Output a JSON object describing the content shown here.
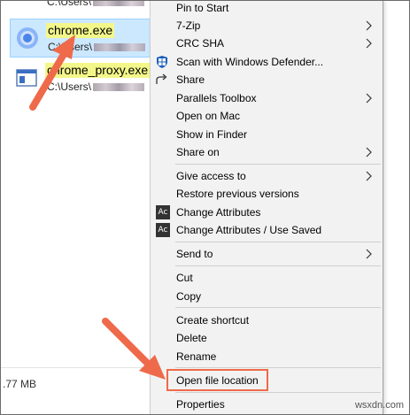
{
  "results": {
    "partial_path_top": "C:\\Users\\",
    "items": [
      {
        "name": "chrome.exe",
        "path_prefix": "C:\\Users\\"
      },
      {
        "name": "chrome_proxy.exe",
        "path_prefix": "C:\\Users\\"
      }
    ],
    "size_text": ".77 MB"
  },
  "menu": {
    "pin_to_start": "Pin to Start",
    "seven_zip": "7-Zip",
    "crc_sha": "CRC SHA",
    "scan_defender": "Scan with Windows Defender...",
    "share": "Share",
    "parallels_toolbox": "Parallels Toolbox",
    "open_on_mac": "Open on Mac",
    "show_in_finder": "Show in Finder",
    "share_on": "Share on",
    "give_access_to": "Give access to",
    "restore_previous": "Restore previous versions",
    "change_attributes": "Change Attributes",
    "change_attributes_saved": "Change Attributes / Use Saved",
    "send_to": "Send to",
    "cut": "Cut",
    "copy": "Copy",
    "create_shortcut": "Create shortcut",
    "delete": "Delete",
    "rename": "Rename",
    "open_file_location": "Open file location",
    "properties": "Properties",
    "ac_icon_text": "Ac"
  },
  "watermark": "wsxdn.com",
  "colors": {
    "selection": "#cce8ff",
    "highlight_name": "#f3f78a",
    "annotation_arrow": "#ef6a4a",
    "menu_bg": "#f2f2f2"
  }
}
